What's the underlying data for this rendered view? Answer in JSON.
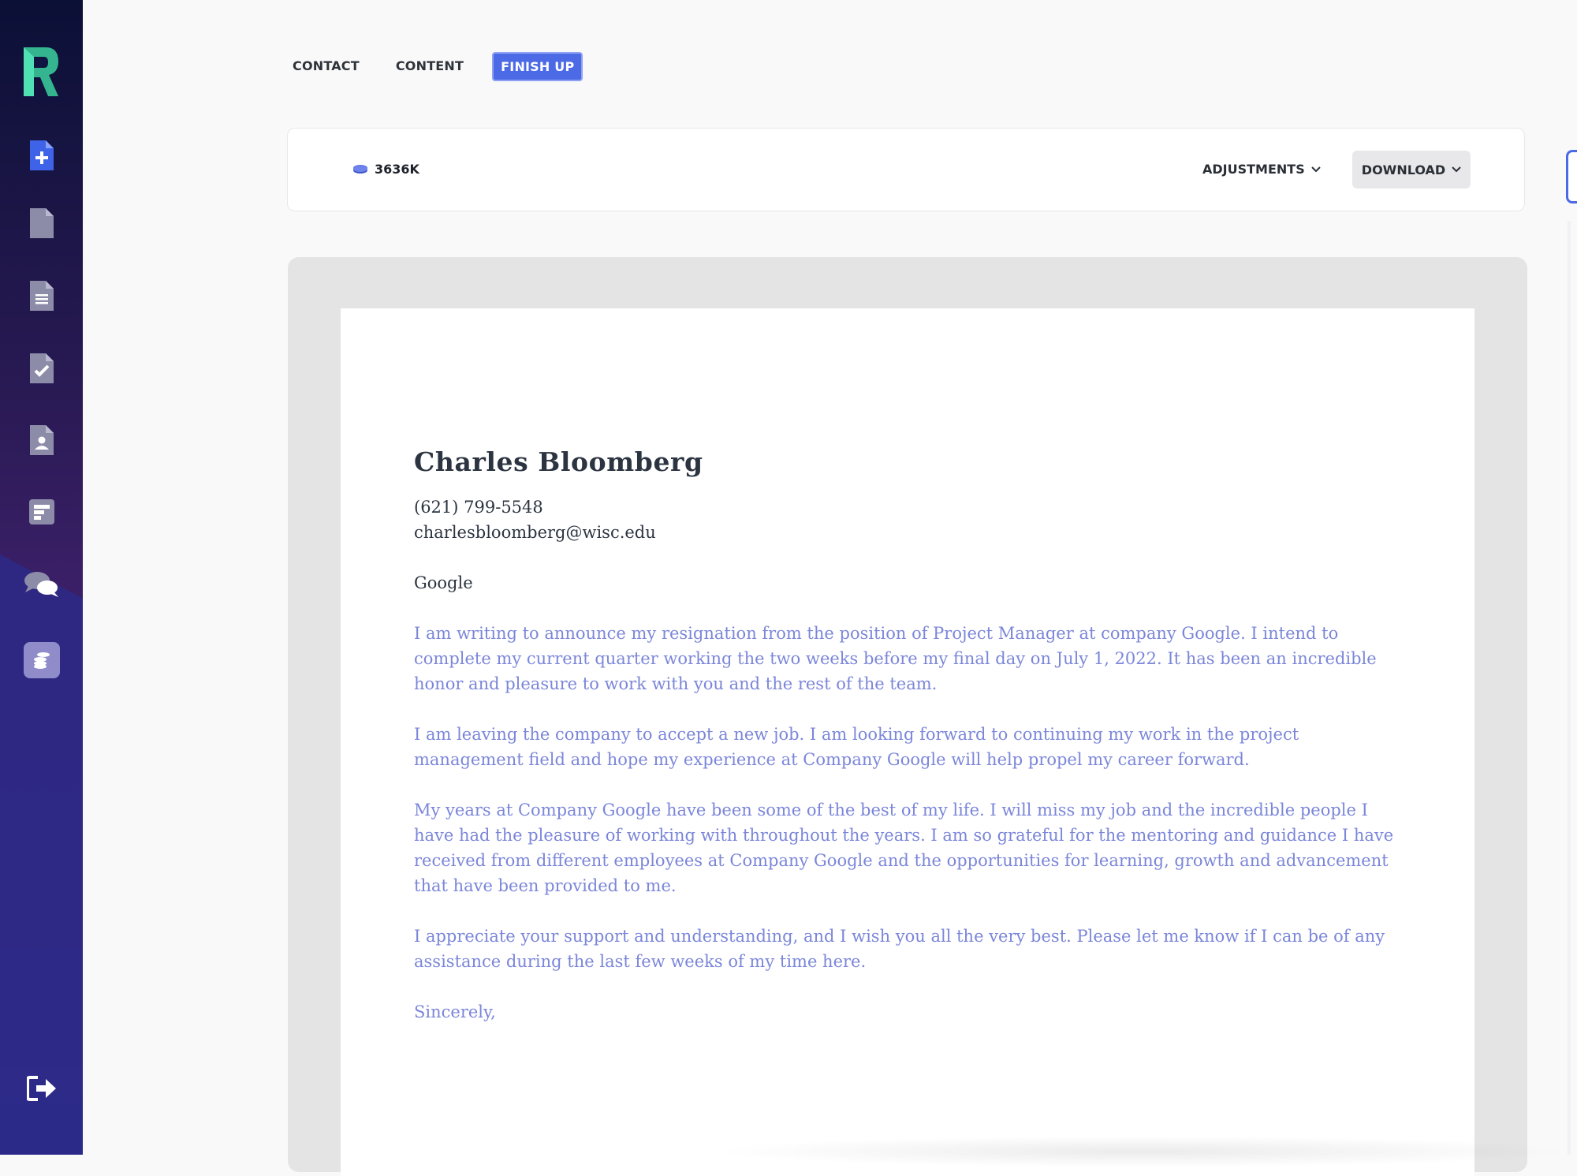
{
  "sidebar": {
    "logo": "R",
    "items": [
      {
        "icon": "new-document-icon"
      },
      {
        "icon": "document-icon"
      },
      {
        "icon": "document-lines-icon"
      },
      {
        "icon": "document-check-icon"
      },
      {
        "icon": "document-user-icon"
      },
      {
        "icon": "align-left-icon"
      },
      {
        "icon": "chat-bubbles-icon"
      },
      {
        "icon": "coins-icon",
        "active": true
      }
    ],
    "logout_icon": "sign-out-icon"
  },
  "tabs": [
    {
      "label": "CONTACT"
    },
    {
      "label": "CONTENT"
    },
    {
      "label": "FINISH UP",
      "active": true
    }
  ],
  "toolbar": {
    "credits": "3636K",
    "adjustments_label": "ADJUSTMENTS",
    "download_label": "DOWNLOAD"
  },
  "letter": {
    "name": "Charles Bloomberg",
    "phone": "(621) 799-5548",
    "email": "charlesbloomberg@wisc.edu",
    "company": "Google",
    "paragraphs": [
      "I am writing to announce my resignation from the position of Project Manager at company Google. I intend to complete my current quarter working the two weeks before my final day on July 1, 2022. It has been an incredible honor and pleasure to work with you and the rest of the team.",
      "I am leaving the company to accept a new job. I am looking forward to continuing my work in the project management field and hope my experience at Company Google will help propel my career forward.",
      "My years at Company Google have been some of the best of my life. I will miss my job and the incredible people I have had the pleasure of working with throughout the years. I am so grateful for the mentoring and guidance I have received from different employees at Company Google and the opportunities for learning, growth and advancement that have been provided to me.",
      "I appreciate your support and understanding, and I wish you all the very best. Please let me know if I can be of any assistance during the last few weeks of my time here."
    ],
    "closing": "Sincerely,"
  },
  "colors": {
    "accent": "#4c6ae6",
    "logo": "#3ec9a0",
    "body_text_highlight": "#7b86d9"
  }
}
